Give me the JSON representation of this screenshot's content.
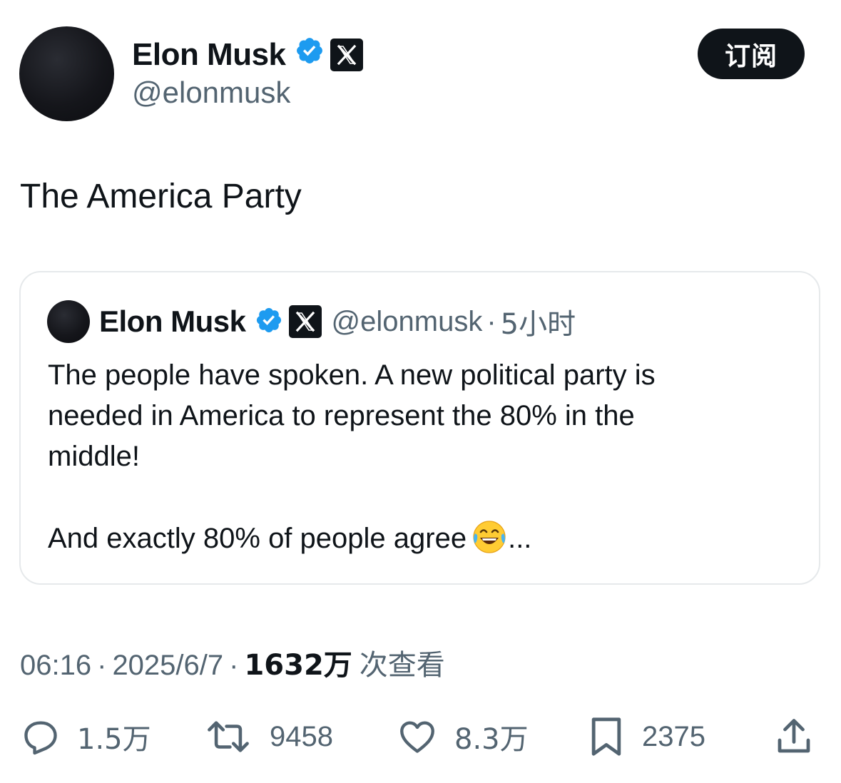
{
  "author": {
    "name": "Elon Musk",
    "handle": "@elonmusk"
  },
  "subscribe_label": "订阅",
  "tweet_text": "The America Party",
  "quote": {
    "name": "Elon Musk",
    "handle": "@elonmusk",
    "separator": "·",
    "time": "5小时",
    "body": "The people have spoken. A new political party is\nneeded in America to represent the 80% in the\nmiddle!\n\nAnd exactly 80% of people agree",
    "emoji": "face-with-tears-of-joy",
    "ellipsis": "..."
  },
  "meta": {
    "time": "06:16",
    "separator": "·",
    "date": "2025/6/7",
    "views": "1632万",
    "views_label": "次查看"
  },
  "actions": {
    "replies": "1.5万",
    "reposts": "9458",
    "likes": "8.3万",
    "bookmarks": "2375"
  },
  "icons": {
    "verified": "verified-badge-icon",
    "affiliate": "x-logo-icon",
    "reply": "reply-icon",
    "repost": "repost-icon",
    "like": "heart-icon",
    "bookmark": "bookmark-icon",
    "share": "share-icon"
  },
  "colors": {
    "verified_blue": "#1d9bf0",
    "text": "#0f1419",
    "secondary": "#536471",
    "border": "#e6e9eb"
  }
}
